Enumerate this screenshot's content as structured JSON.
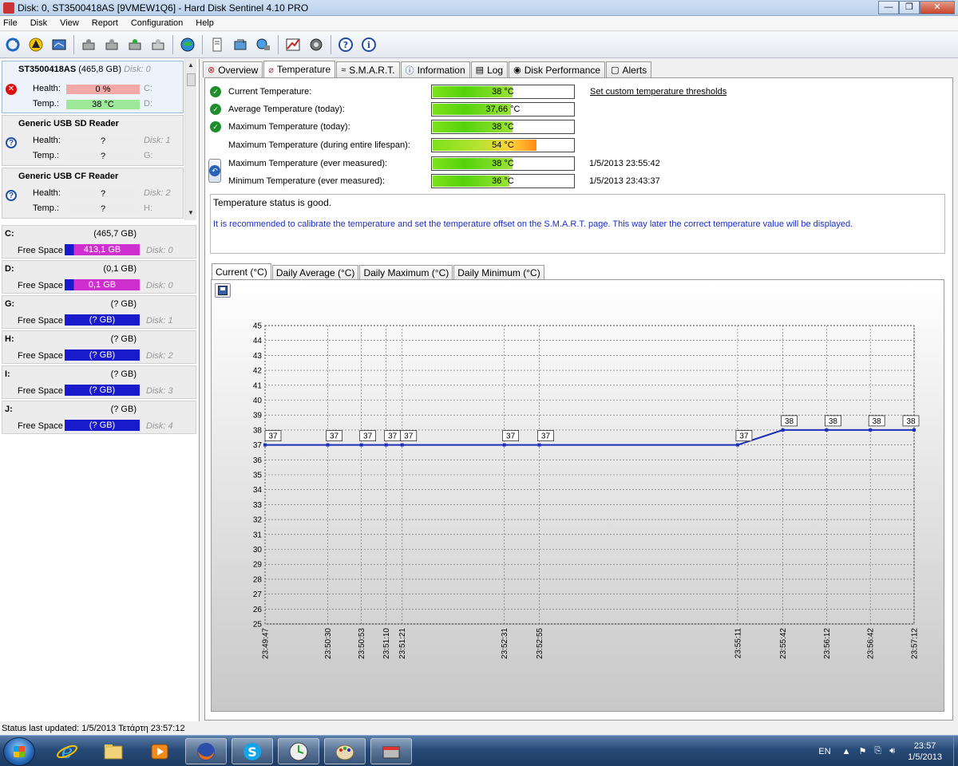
{
  "window": {
    "title": "Disk: 0, ST3500418AS [9VMEW1Q6]  -  Hard Disk Sentinel 4.10 PRO",
    "minimize": "—",
    "maximize": "❐",
    "close": "✕"
  },
  "menu": [
    "File",
    "Disk",
    "View",
    "Report",
    "Configuration",
    "Help"
  ],
  "toolbar_icons": [
    "refresh-icon",
    "warning-icon",
    "report-icon",
    "disk-1-icon",
    "disk-2-icon",
    "disk-3-icon",
    "disk-4-icon",
    "web-icon",
    "document-icon",
    "repair-icon",
    "network-icon",
    "chart-icon",
    "settings-icon",
    "help-icon",
    "info-icon"
  ],
  "disks": [
    {
      "name": "ST3500418AS",
      "size": "(465,8 GB)",
      "disk": "Disk: 0",
      "health_label": "Health:",
      "health": "0 %",
      "temp_label": "Temp.:",
      "temp": "38 °C",
      "drive1": "C:",
      "drive2": "D:",
      "status": "error"
    },
    {
      "name": "Generic USB SD Reader",
      "size": "",
      "disk": "",
      "health_label": "Health:",
      "health": "?",
      "temp_label": "Temp.:",
      "temp": "?",
      "drive1": "Disk: 1",
      "drive2": "G:",
      "status": "unknown"
    },
    {
      "name": "Generic USB CF Reader",
      "size": "",
      "disk": "",
      "health_label": "Health:",
      "health": "?",
      "temp_label": "Temp.:",
      "temp": "?",
      "drive1": "Disk: 2",
      "drive2": "H:",
      "status": "unknown"
    }
  ],
  "partitions": [
    {
      "letter": "C:",
      "size": "(465,7 GB)",
      "free_label": "Free Space",
      "free": "413,1 GB",
      "disk": "Disk: 0",
      "used_fraction": 0.11
    },
    {
      "letter": "D:",
      "size": "(0,1 GB)",
      "free_label": "Free Space",
      "free": "0,1 GB",
      "disk": "Disk: 0",
      "used_fraction": 0.12
    },
    {
      "letter": "G:",
      "size": "(? GB)",
      "free_label": "Free Space",
      "free": "(? GB)",
      "disk": "Disk: 1"
    },
    {
      "letter": "H:",
      "size": "(? GB)",
      "free_label": "Free Space",
      "free": "(? GB)",
      "disk": "Disk: 2"
    },
    {
      "letter": "I:",
      "size": "(? GB)",
      "free_label": "Free Space",
      "free": "(? GB)",
      "disk": "Disk: 3"
    },
    {
      "letter": "J:",
      "size": "(? GB)",
      "free_label": "Free Space",
      "free": "(? GB)",
      "disk": "Disk: 4"
    }
  ],
  "tabs": [
    "Overview",
    "Temperature",
    "S.M.A.R.T.",
    "Information",
    "Log",
    "Disk Performance",
    "Alerts"
  ],
  "active_tab": "Temperature",
  "temperature": {
    "rows": [
      {
        "label": "Current Temperature:",
        "value": "38 °C",
        "level": 0.56,
        "date": "",
        "check": true
      },
      {
        "label": "Average Temperature (today):",
        "value": "37,66 °C",
        "level": 0.55,
        "date": "",
        "check": true
      },
      {
        "label": "Maximum Temperature (today):",
        "value": "38 °C",
        "level": 0.56,
        "date": "",
        "check": true
      },
      {
        "label": "Maximum Temperature (during entire lifespan):",
        "value": "54 °C",
        "level": 0.73,
        "date": "",
        "check": false
      },
      {
        "label": "Maximum Temperature (ever measured):",
        "value": "38 °C",
        "level": 0.56,
        "date": "1/5/2013 23:55:42",
        "check": false
      },
      {
        "label": "Minimum Temperature (ever measured):",
        "value": "36 °C",
        "level": 0.54,
        "date": "1/5/2013 23:43:37",
        "check": false
      }
    ],
    "thresholds_link": "Set custom temperature thresholds",
    "status_message": "Temperature status is good.",
    "calibrate_message": "It is recommended to calibrate the temperature and set the temperature offset on the S.M.A.R.T. page. This way later the correct temperature value will be displayed."
  },
  "chart_tabs": [
    "Current (°C)",
    "Daily Average (°C)",
    "Daily Maximum (°C)",
    "Daily Minimum (°C)"
  ],
  "chart_data": {
    "type": "line",
    "x": [
      "23:49:47",
      "23:50:30",
      "23:50:53",
      "23:51:10",
      "23:51:21",
      "23:52:31",
      "23:52:55",
      "23:55:11",
      "23:55:42",
      "23:56:12",
      "23:56:42",
      "23:57:12"
    ],
    "x_seconds": [
      0,
      43,
      66,
      83,
      94,
      164,
      188,
      324,
      355,
      385,
      415,
      445
    ],
    "values": [
      37,
      37,
      37,
      37,
      37,
      37,
      37,
      37,
      38,
      38,
      38,
      38
    ],
    "ylim": [
      25,
      45
    ],
    "yticks": [
      25,
      26,
      27,
      28,
      29,
      30,
      31,
      32,
      33,
      34,
      35,
      36,
      37,
      38,
      39,
      40,
      41,
      42,
      43,
      44,
      45
    ],
    "grid": true,
    "line_color": "#1c2fb8"
  },
  "status_bar": "Status last updated: 1/5/2013 Τετάρτη 23:57:12",
  "taskbar": {
    "apps": [
      "internet-explorer",
      "explorer",
      "media-player",
      "firefox",
      "skype",
      "clock-app",
      "paint",
      "hard-disk-sentinel"
    ],
    "lang": "EN",
    "time": "23:57",
    "date": "1/5/2013"
  }
}
